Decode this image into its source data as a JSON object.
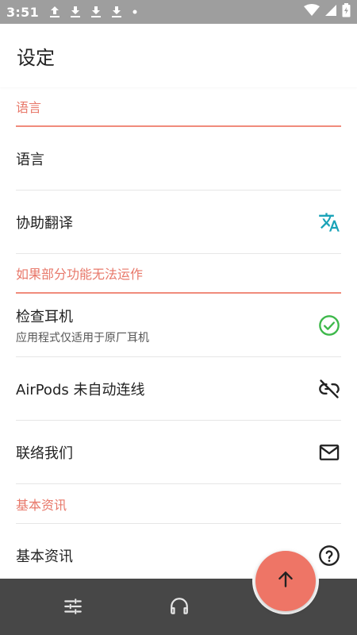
{
  "status_bar": {
    "time": "3:51",
    "notification_icons": [
      "upload-icon",
      "download-icon",
      "download-icon",
      "download-icon",
      "dot-icon"
    ],
    "system_icons": [
      "wifi-icon",
      "cellular-icon",
      "battery-icon"
    ]
  },
  "app_bar": {
    "title": "设定"
  },
  "sections": {
    "language": {
      "header": "语言",
      "items": [
        {
          "label": "语言"
        },
        {
          "label": "协助翻译",
          "icon": "translate-icon"
        }
      ]
    },
    "troubleshoot": {
      "header": "如果部分功能无法运作",
      "items": [
        {
          "label": "检查耳机",
          "sublabel": "应用程式仅适用于原厂耳机",
          "icon": "check-circle-icon"
        },
        {
          "label": "AirPods 未自动连线",
          "icon": "link-off-icon"
        },
        {
          "label": "联络我们",
          "icon": "mail-icon"
        }
      ]
    },
    "info": {
      "header": "基本资讯",
      "items": [
        {
          "label": "基本资讯",
          "icon": "help-circle-icon"
        }
      ]
    }
  },
  "bottom_nav": {
    "items": [
      "sliders-icon",
      "headphones-icon"
    ],
    "fab_icon": "arrow-up-icon"
  },
  "colors": {
    "accent": "#ee7566",
    "section_text": "#e8786a",
    "translate_icon": "#1aa3b8",
    "check_icon": "#3db84a",
    "bottom_nav": "#474747",
    "status_bar": "#9e9e9e"
  }
}
